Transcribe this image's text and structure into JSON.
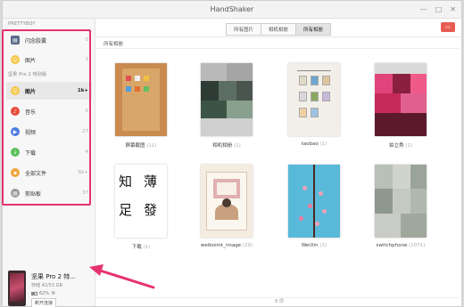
{
  "window": {
    "title": "HandShaker",
    "controls": [
      "—",
      "□",
      "✕"
    ]
  },
  "sidebar": {
    "computer_label": "PRETTYBOY",
    "computer_items": [
      {
        "label": "闪念胶囊",
        "count": "0",
        "icon": "capsule-icon",
        "color": "#5a6b8c"
      },
      {
        "label": "图片",
        "count": "1",
        "icon": "photo-icon",
        "color": "#f5c542"
      }
    ],
    "device_label": "坚果 Pro 2 特别版",
    "device_items": [
      {
        "label": "图片",
        "count": "1k+",
        "icon": "photo-icon",
        "color": "#f5c542",
        "active": true
      },
      {
        "label": "音乐",
        "count": "0",
        "icon": "music-icon",
        "color": "#e94b3c"
      },
      {
        "label": "视频",
        "count": "27",
        "icon": "video-icon",
        "color": "#4a7be0"
      },
      {
        "label": "下载",
        "count": "4",
        "icon": "download-icon",
        "color": "#5bbf5b"
      },
      {
        "label": "全部文件",
        "count": "6k+",
        "icon": "folder-icon",
        "color": "#f0a43a"
      },
      {
        "label": "剪贴板",
        "count": "37",
        "icon": "clipboard-icon",
        "color": "#999999"
      }
    ]
  },
  "device": {
    "name": "坚果 Pro 2 特...",
    "storage": "存储 42/53 GB",
    "battery": "62%",
    "button": "断开连接"
  },
  "toolbar": {
    "tabs": [
      "所有图片",
      "相机相册",
      "所有相册"
    ],
    "active_tab": 2,
    "action_icon": "delete-icon"
  },
  "breadcrumb": "所有相册",
  "albums": [
    {
      "name": "屏幕截图",
      "count": "(11)"
    },
    {
      "name": "相机相册",
      "count": "(1)"
    },
    {
      "name": "taobao",
      "count": "(1)"
    },
    {
      "name": "拍立秀",
      "count": "(1)"
    },
    {
      "name": "下载",
      "count": "(1)"
    },
    {
      "name": "weiboimt_image",
      "count": "(29)"
    },
    {
      "name": "WeiXin",
      "count": "(1)"
    },
    {
      "name": "switchphone",
      "count": "(1071)"
    }
  ],
  "calligraphy": [
    "知",
    "薄",
    "足",
    "發"
  ],
  "status": "8 项",
  "accent": "#e6336f"
}
